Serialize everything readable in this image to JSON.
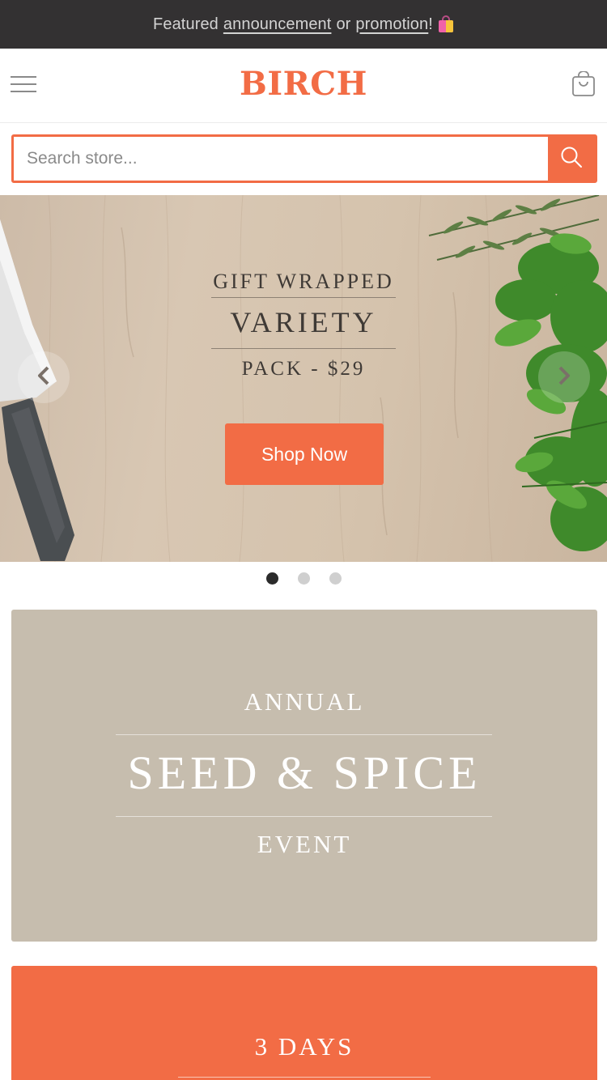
{
  "announcement": {
    "prefix": "Featured",
    "link1": "announcement",
    "middle": "or",
    "link2": "promotion",
    "suffix": "!",
    "icon": "shopping-bags-emoji"
  },
  "header": {
    "logo": "BIRCH",
    "menu_icon": "hamburger-icon",
    "cart_icon": "shopping-bag-icon"
  },
  "search": {
    "placeholder": "Search store...",
    "value": "",
    "button_icon": "search-icon"
  },
  "hero": {
    "line1": "GIFT WRAPPED",
    "line2": "VARIETY",
    "line3": "PACK - $29",
    "cta": "Shop Now",
    "prev_icon": "chevron-left-icon",
    "next_icon": "chevron-right-icon",
    "slides_total": 3,
    "active_slide": 1
  },
  "promo_event": {
    "line1": "ANNUAL",
    "line2": "SEED & SPICE",
    "line3": "EVENT"
  },
  "promo_days": {
    "line1": "3 DAYS"
  },
  "colors": {
    "accent": "#f26c45",
    "announcement_bg": "#333132",
    "promo_bg": "#c6bdae"
  }
}
